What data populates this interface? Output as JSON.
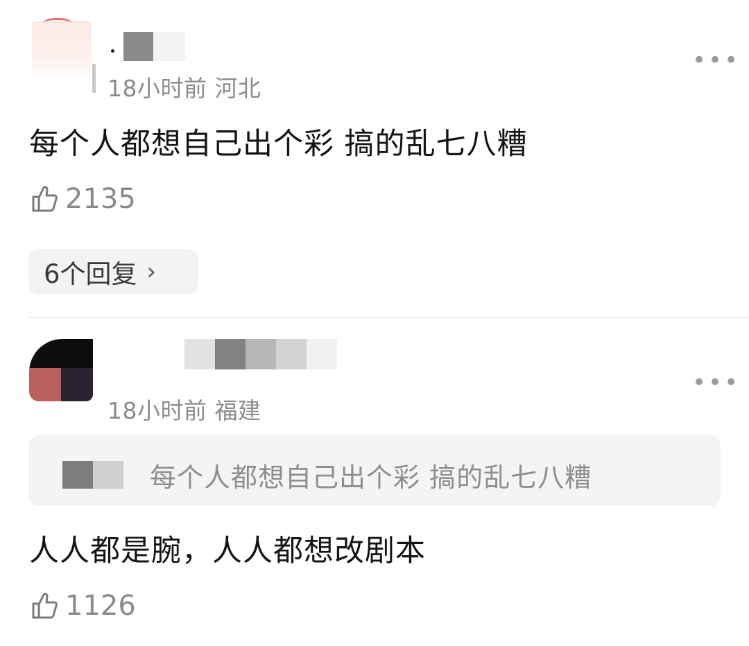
{
  "comments": [
    {
      "meta": "18小时前 河北",
      "more": "•••",
      "content": "每个人都想自己出个彩 搞的乱七八糟",
      "likes": "2135",
      "replies_label": "6个回复",
      "replies_chevron": "›"
    },
    {
      "meta": "18小时前 福建",
      "more": "•••",
      "quote": "每个人都想自己出个彩 搞的乱七八糟",
      "content": "人人都是腕，人人都想改剧本",
      "likes": "1126"
    }
  ],
  "icons": {
    "like": "thumbs-up-icon",
    "more": "more-dots-icon",
    "chevron": "chevron-right-icon"
  },
  "colors": {
    "meta_text": "#8c8c8c",
    "content_text": "#141414",
    "reply_bg": "#f3f3f3",
    "quote_bg": "#f4f4f4"
  }
}
